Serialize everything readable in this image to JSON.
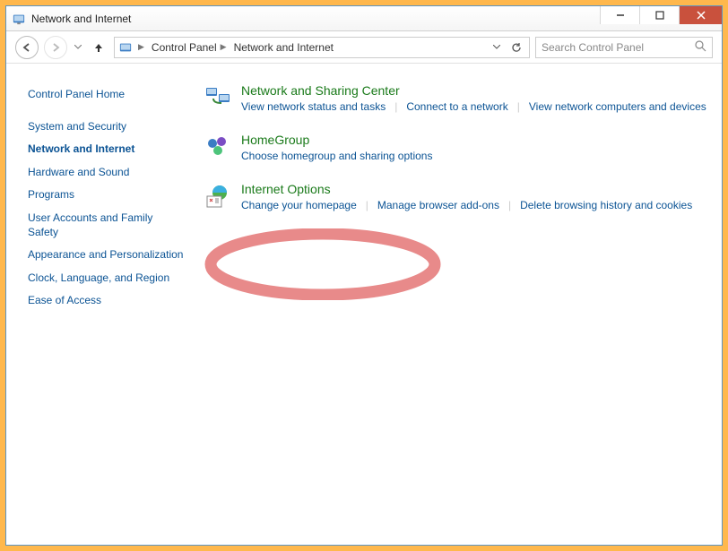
{
  "window": {
    "title": "Network and Internet"
  },
  "toolbar": {
    "breadcrumbs": [
      "Control Panel",
      "Network and Internet"
    ],
    "search_placeholder": "Search Control Panel"
  },
  "sidebar": {
    "items": [
      {
        "label": "Control Panel Home",
        "active": false
      },
      {
        "label": "System and Security",
        "active": false
      },
      {
        "label": "Network and Internet",
        "active": true
      },
      {
        "label": "Hardware and Sound",
        "active": false
      },
      {
        "label": "Programs",
        "active": false
      },
      {
        "label": "User Accounts and Family Safety",
        "active": false
      },
      {
        "label": "Appearance and Personalization",
        "active": false
      },
      {
        "label": "Clock, Language, and Region",
        "active": false
      },
      {
        "label": "Ease of Access",
        "active": false
      }
    ]
  },
  "main": {
    "categories": [
      {
        "title": "Network and Sharing Center",
        "links": [
          "View network status and tasks",
          "Connect to a network",
          "View network computers and devices"
        ]
      },
      {
        "title": "HomeGroup",
        "links": [
          "Choose homegroup and sharing options"
        ]
      },
      {
        "title": "Internet Options",
        "links": [
          "Change your homepage",
          "Manage browser add-ons",
          "Delete browsing history and cookies"
        ]
      }
    ]
  }
}
